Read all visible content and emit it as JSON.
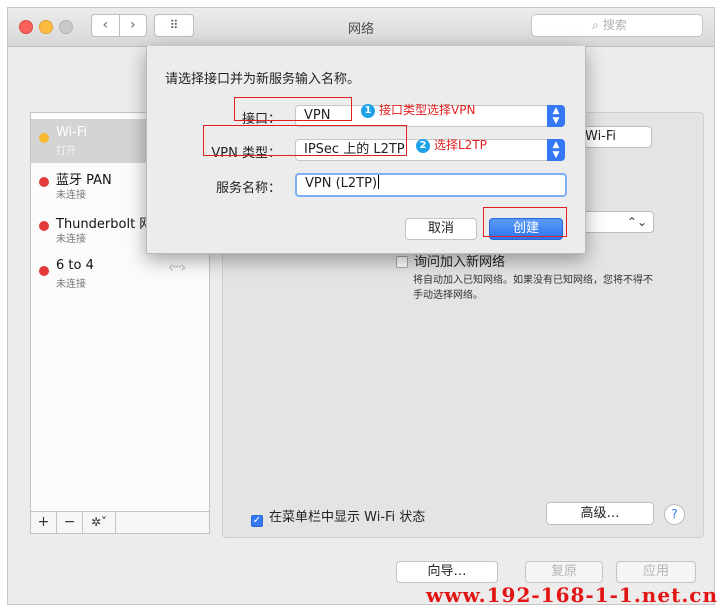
{
  "window": {
    "title": "网络",
    "nav_back": "‹",
    "nav_forward": "›",
    "grid_icon": "⠿",
    "search_placeholder": "搜索"
  },
  "sidebar": {
    "services": [
      {
        "name": "Wi-Fi",
        "status": "打开",
        "color": "#f5b82e",
        "selected": true
      },
      {
        "name": "蓝牙 PAN",
        "status": "未连接",
        "color": "#e23a3a"
      },
      {
        "name": "Thunderbolt 网",
        "status": "未连接",
        "color": "#e23a3a"
      },
      {
        "name": "6 to 4",
        "status": "未连接",
        "color": "#e23a3a"
      }
    ],
    "tools": {
      "add": "+",
      "remove": "−",
      "gear": "✲˅"
    },
    "conn_arrows": "‹···›"
  },
  "main": {
    "wifi_button": "Wi-Fi",
    "network_select_arrow": "⌃⌄",
    "ask_join_label": "询问加入新网络",
    "ask_join_note": "将自动加入已知网络。如果没有已知网络，您将不得不手动选择网络。",
    "show_status_label": "在菜单栏中显示 Wi-Fi 状态",
    "advanced_button": "高级…",
    "help_button": "?"
  },
  "footer": {
    "assist_button": "向导…",
    "revert_button": "复原",
    "apply_button": "应用"
  },
  "dialog": {
    "prompt": "请选择接口并为新服务输入名称。",
    "interface_label": "接口：",
    "interface_value": "VPN",
    "vpn_type_label": "VPN 类型：",
    "vpn_type_value": "IPSec 上的 L2TP",
    "service_name_label": "服务名称：",
    "service_name_value": "VPN (L2TP)",
    "cancel_button": "取消",
    "create_button": "创建"
  },
  "annotations": {
    "step1_num": "1",
    "step1_text": "接口类型选择VPN",
    "step2_num": "2",
    "step2_text": "选择L2TP"
  },
  "watermark": "www.192-168-1-1.net.cn",
  "colors": {
    "accent": "#3478f6",
    "annotation": "#e02020",
    "watermark": "#e31414"
  }
}
